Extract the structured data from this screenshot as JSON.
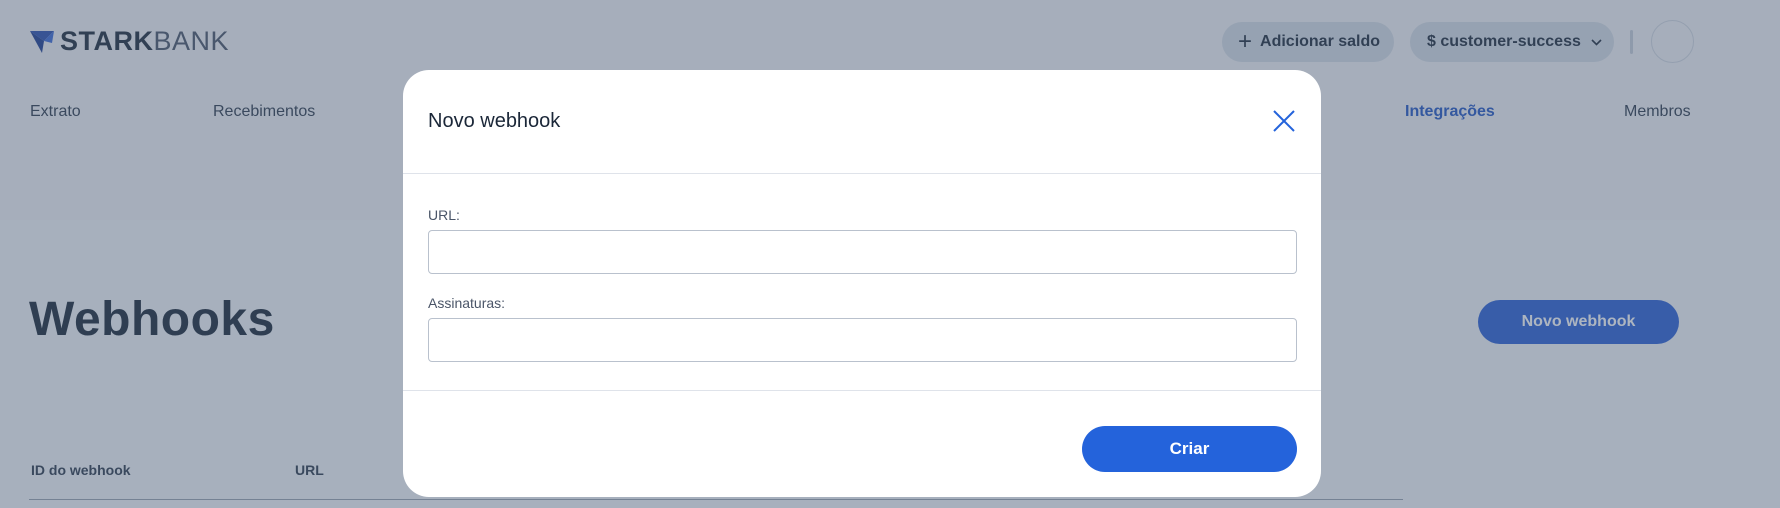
{
  "header": {
    "logo": {
      "strong": "STARK",
      "light": "BANK"
    },
    "add_balance_label": "Adicionar saldo",
    "account_label": "$ customer-success"
  },
  "nav": {
    "items": [
      {
        "label": "Extrato"
      },
      {
        "label": "Recebimentos"
      },
      {
        "label": "Integrações",
        "active": true
      },
      {
        "label": "Membros"
      }
    ]
  },
  "page": {
    "title": "Webhooks",
    "new_button_label": "Novo webhook",
    "table": {
      "columns": [
        "ID do webhook",
        "URL"
      ]
    }
  },
  "modal": {
    "title": "Novo webhook",
    "url_label": "URL:",
    "url_value": "",
    "signatures_label": "Assinaturas:",
    "signatures_value": "",
    "submit_label": "Criar"
  },
  "colors": {
    "accent": "#2463db",
    "active_nav": "#2356c4",
    "overlay": "rgba(74, 90, 115, 0.45)"
  },
  "icons": {
    "logo": "starkbank-logo-mark",
    "add": "plus-icon",
    "account_dropdown": "chevron-down-icon",
    "close": "close-icon"
  }
}
